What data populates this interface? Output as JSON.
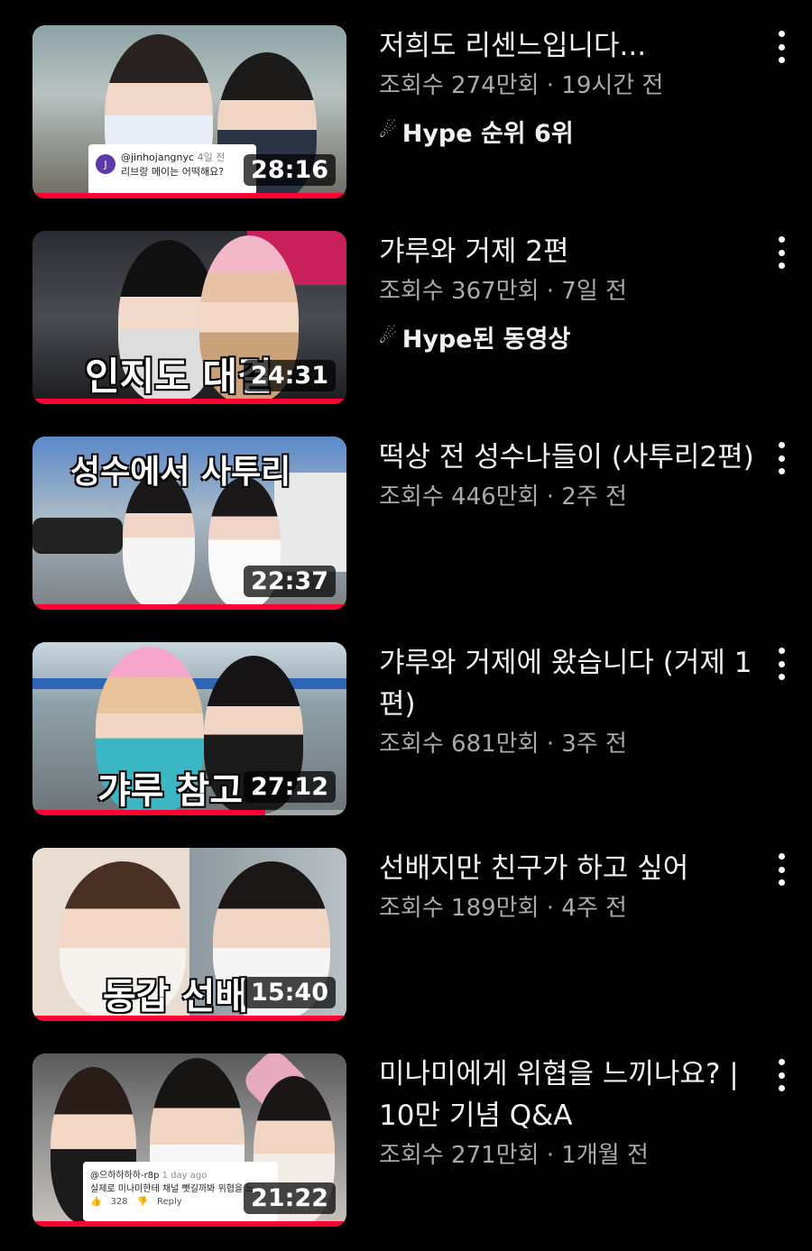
{
  "videos": [
    {
      "title": "저희도 리센느입니다...",
      "views": "조회수 274만회",
      "age": "19시간 전",
      "hype": "Hype 순위 6위",
      "duration": "28:16",
      "progress": 1.0,
      "comment_user": "@jinhojangnyc",
      "comment_time": "4일 전",
      "comment_text": "리브랑 메이는 어떡해요?"
    },
    {
      "title": "갸루와 거제 2편",
      "views": "조회수 367만회",
      "age": "7일 전",
      "hype": "Hype된 동영상",
      "duration": "24:31",
      "progress": 1.0,
      "overlay": "인지도 대결"
    },
    {
      "title": "떡상 전 성수나들이 (사투리2편)",
      "views": "조회수 446만회",
      "age": "2주 전",
      "duration": "22:37",
      "progress": 1.0,
      "overlay": "성수에서 사투리"
    },
    {
      "title": "갸루와 거제에 왔습니다 (거제 1편)",
      "views": "조회수 681만회",
      "age": "3주 전",
      "duration": "27:12",
      "progress": 0.74,
      "overlay": "갸루 참고"
    },
    {
      "title": "선배지만 친구가 하고 싶어",
      "views": "조회수 189만회",
      "age": "4주 전",
      "duration": "15:40",
      "progress": 0.99,
      "overlay": "동갑 선배"
    },
    {
      "title": "미나미에게 위협을 느끼나요? | 10만 기념 Q&A",
      "views": "조회수 271만회",
      "age": "1개월 전",
      "duration": "21:22",
      "progress": 1.0,
      "comment_user": "@으하하하하-r8p",
      "comment_time": "1 day ago",
      "comment_text": "실제로 미나미한테 채널 뺏길까봐 위협을 느...",
      "comment_likes": "328",
      "comment_reply": "Reply"
    }
  ],
  "separator": " · ",
  "colors": {
    "progress": "#ff0033",
    "subtext": "#aaaaaa",
    "background": "#000000"
  },
  "icons": {
    "hype": "hype-megaphone-icon",
    "more": "more-vert-icon"
  }
}
